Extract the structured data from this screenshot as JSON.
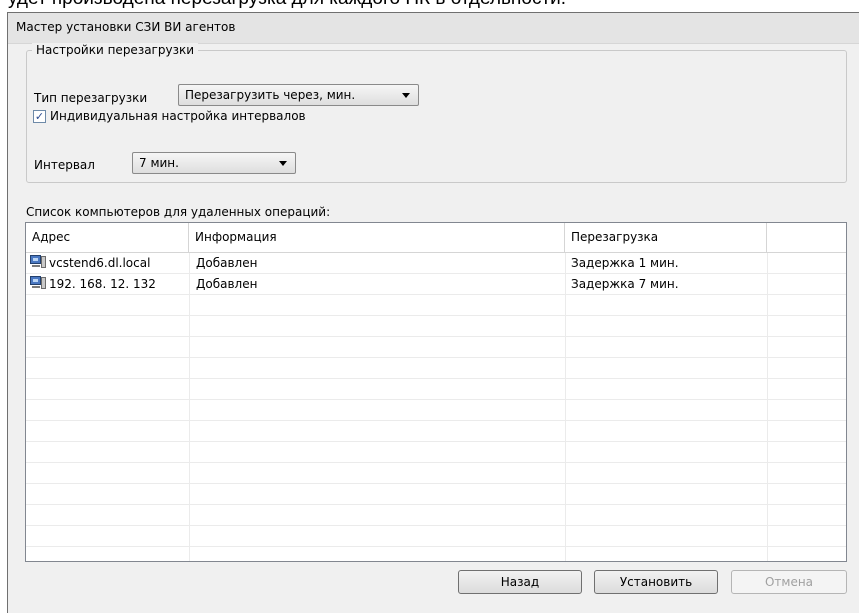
{
  "document": {
    "text": "удет производена перезагрузка для каждого ПК в отдельности."
  },
  "window": {
    "title": "Мастер установки СЗИ ВИ агентов"
  },
  "reboot_settings": {
    "group_label": "Настройки перезагрузки",
    "type_label": "Тип перезагрузки",
    "type_value": "Перезагрузить через, мин.",
    "individual_checkbox_label": "Индивидуальная настройка интервалов",
    "individual_checked": true,
    "interval_label": "Интервал",
    "interval_value": "7 мин."
  },
  "computers": {
    "list_label": "Список компьютеров для удаленных операций:",
    "columns": [
      "Адрес",
      "Информация",
      "Перезагрузка"
    ],
    "rows": [
      {
        "address": "vcstend6.dl.local",
        "info": "Добавлен",
        "reboot": "Задержка 1 мин.",
        "icon": "computer-icon"
      },
      {
        "address": "192. 168. 12. 132",
        "info": "Добавлен",
        "reboot": "Задержка 7 мин.",
        "icon": "computer-icon"
      }
    ]
  },
  "buttons": {
    "back": "Назад",
    "install": "Установить",
    "cancel": "Отмена",
    "cancel_enabled": false
  }
}
